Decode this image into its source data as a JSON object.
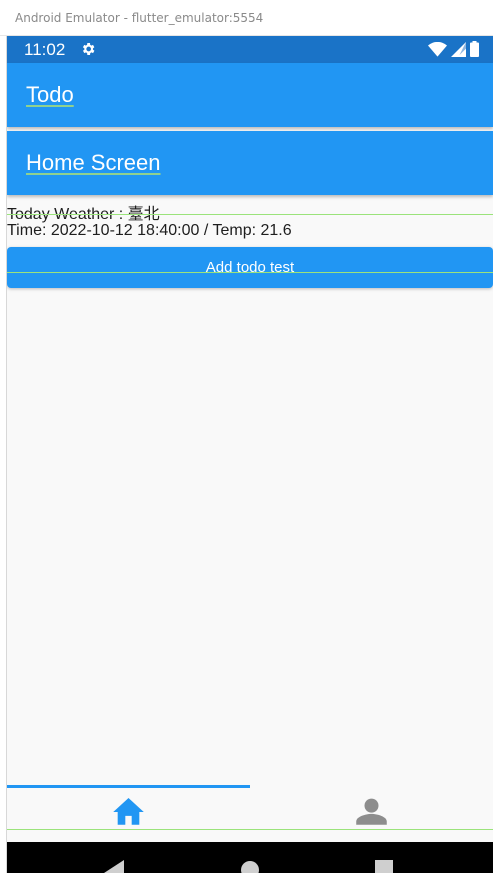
{
  "window": {
    "title": "Android Emulator - flutter_emulator:5554"
  },
  "status_bar": {
    "time": "11:02",
    "gear_icon": "settings-icon",
    "wifi_icon": "wifi-icon",
    "signal_icon": "signal-icon",
    "battery_icon": "battery-icon"
  },
  "app_bars": [
    {
      "title": "Todo"
    },
    {
      "title": "Home Screen"
    }
  ],
  "weather": {
    "line1": "Today Weather : 臺北",
    "line2": "Time: 2022-10-12 18:40:00 / Temp: 21.6"
  },
  "add_button": {
    "label": "Add todo test"
  },
  "bottom_nav": {
    "selected_index": 0,
    "items": [
      {
        "icon": "home-icon"
      },
      {
        "icon": "person-icon"
      }
    ]
  },
  "colors": {
    "primary": "#2196f3",
    "status_bar": "#1a73c7",
    "inactive_icon": "#8d8d8d",
    "guide_line": "#9be37b"
  }
}
